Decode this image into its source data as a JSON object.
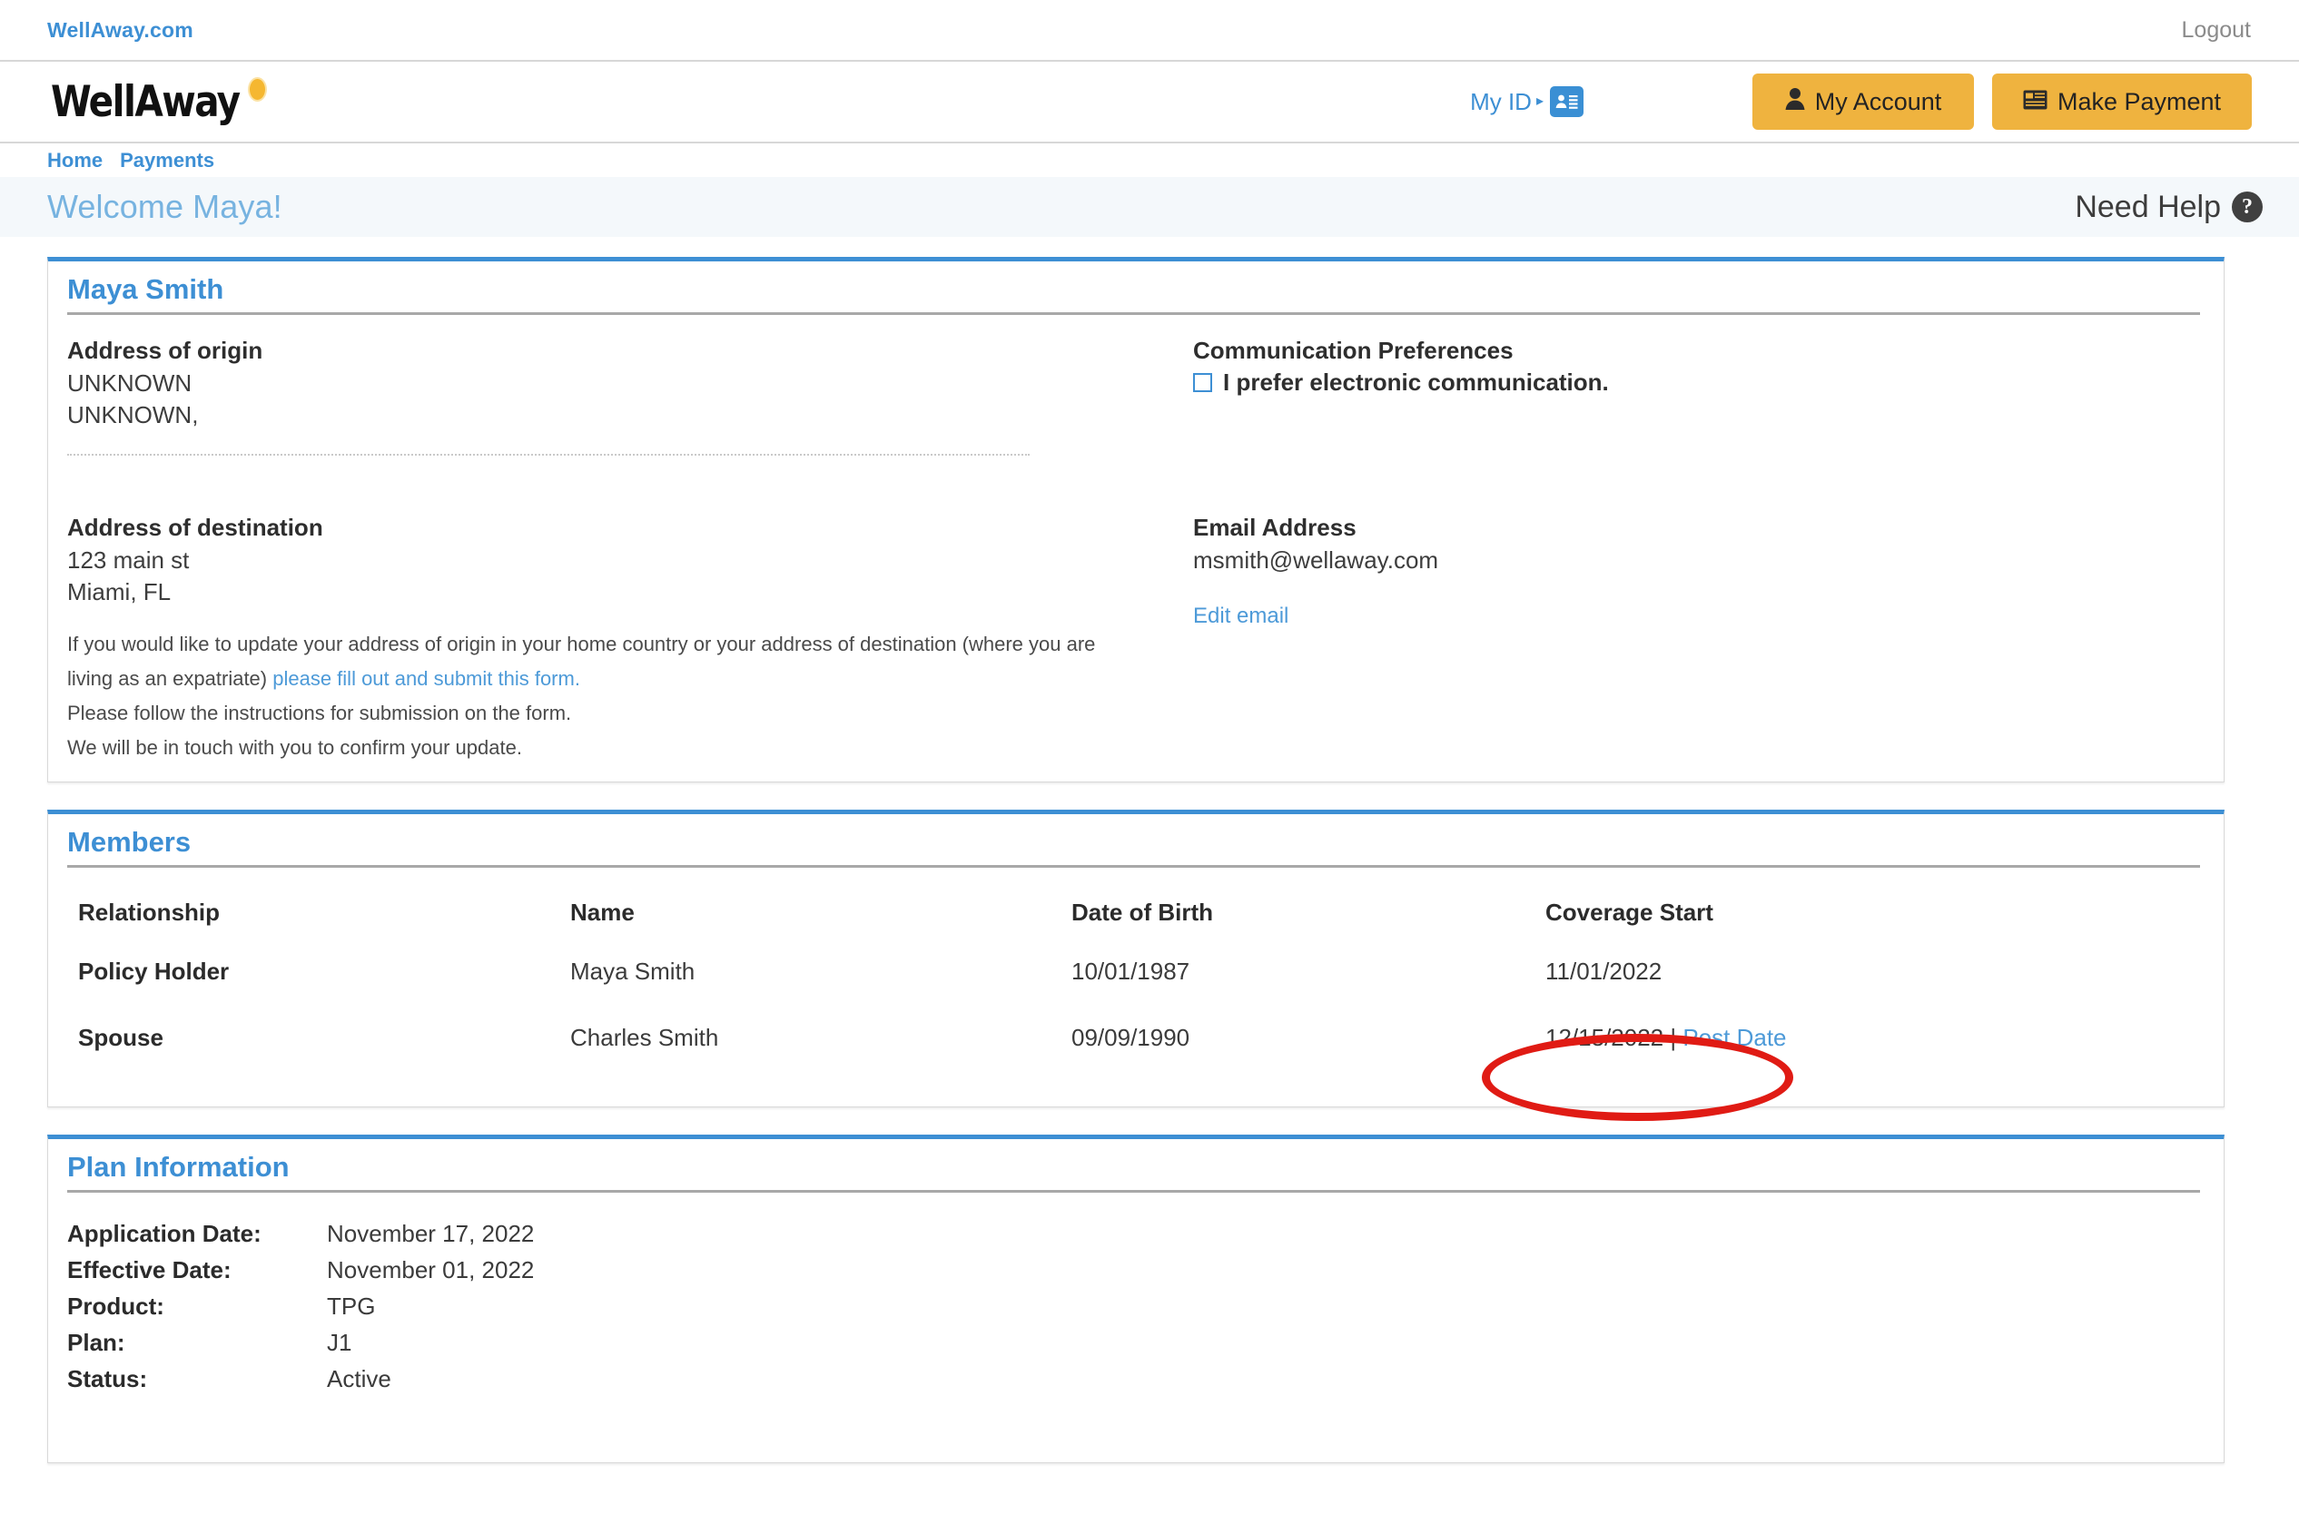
{
  "topbar": {
    "site_link": "WellAway.com",
    "logout": "Logout"
  },
  "header": {
    "logo_text": "WellAway",
    "my_id_label": "My ID",
    "my_id_caret": "▸",
    "my_id_icon": "id-card-icon",
    "my_account_label": "My Account",
    "my_account_icon": "person-icon",
    "make_payment_label": "Make Payment",
    "make_payment_icon": "credit-card-icon"
  },
  "breadcrumb": {
    "items": [
      {
        "label": "Home"
      },
      {
        "label": "Payments"
      }
    ]
  },
  "welcome": {
    "greeting": "Welcome Maya!",
    "need_help": "Need Help",
    "help_icon": "?"
  },
  "profile": {
    "title": "Maya Smith",
    "address_origin": {
      "label": "Address of origin",
      "line1": "UNKNOWN",
      "line2": "UNKNOWN,"
    },
    "address_destination": {
      "label": "Address of destination",
      "line1": "123 main st",
      "line2": "Miami, FL"
    },
    "communication": {
      "label": "Communication Preferences",
      "checkbox_label": "I prefer electronic communication.",
      "checked": false
    },
    "email": {
      "label": "Email Address",
      "value": "msmith@wellaway.com",
      "edit_link": "Edit email"
    },
    "note": {
      "part1": "If you would like to update your address of origin in your home country or your address of destination (where you are living as an expatriate) ",
      "link": "please fill out and submit this form.",
      "part2": "Please follow the instructions for submission on the form.",
      "part3": "We will be in touch with you to confirm your update."
    }
  },
  "members": {
    "title": "Members",
    "columns": [
      "Relationship",
      "Name",
      "Date of Birth",
      "Coverage Start"
    ],
    "rows": [
      {
        "relationship": "Policy Holder",
        "name": "Maya Smith",
        "dob": "10/01/1987",
        "coverage_start": "11/01/2022",
        "post_date_link": null,
        "separator": null
      },
      {
        "relationship": "Spouse",
        "name": "Charles Smith",
        "dob": "09/09/1990",
        "coverage_start": "12/15/2022",
        "separator": " | ",
        "post_date_link": "Post Date"
      }
    ]
  },
  "plan_information": {
    "title": "Plan Information",
    "rows": [
      {
        "key": "Application Date:",
        "value": "November 17, 2022"
      },
      {
        "key": "Effective Date:",
        "value": "November 01, 2022"
      },
      {
        "key": "Product:",
        "value": "TPG"
      },
      {
        "key": "Plan:",
        "value": "J1"
      },
      {
        "key": "Status:",
        "value": "Active"
      }
    ]
  },
  "annotation": {
    "type": "red-ellipse-highlight",
    "target": "coverage-start-post-date",
    "color": "#e01b14"
  },
  "colors": {
    "brand_blue": "#3d8fd4",
    "accent_amber": "#efb33f",
    "logo_dot": "#f5b731",
    "welcome_bar_bg": "#f4f8fb",
    "link_blue": "#4d9ad8",
    "annotation_red": "#e01b14"
  }
}
